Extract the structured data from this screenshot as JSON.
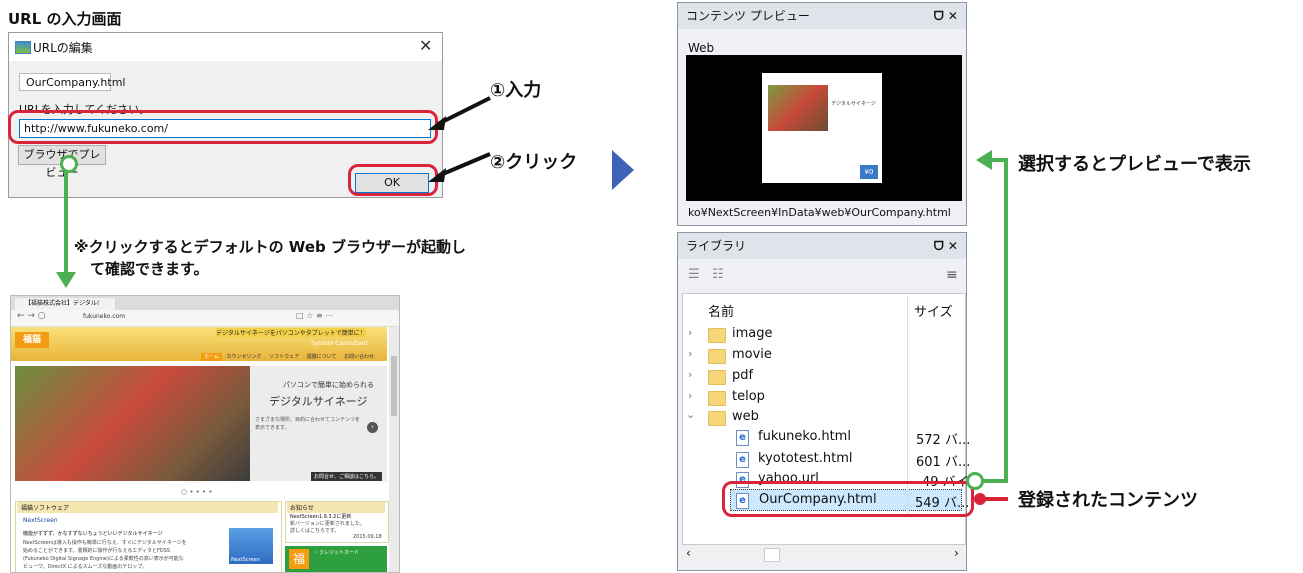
{
  "left_heading": "URL の入力画面",
  "dialog": {
    "title": "URLの編集",
    "name_value": "OurCompany.html",
    "url_label": "URLを入力してください。",
    "url_value": "http://www.fukuneko.com/",
    "preview_button": "ブラウザでプレビュー",
    "ok_button": "OK"
  },
  "annotations": {
    "step1": "①入力",
    "step2": "②クリック",
    "note_line1": "※クリックするとデフォルトの Web ブラウザーが起動し",
    "note_line2": "て確認できます。",
    "select_preview": "選択するとプレビューで表示",
    "registered": "登録されたコンテンツ"
  },
  "browser": {
    "tab_title": "【福猫株式会社】デジタル!",
    "address": "fukuneko.com",
    "banner_top": "デジタルサイネージをパソコンやタブレットで簡単に！",
    "banner_sub": "System Consultant",
    "logo_text": "福猫",
    "nav": [
      "ホーム",
      "カウンセリング",
      "ソフトウェア",
      "福猫について",
      "お問い合わせ"
    ],
    "hero_line1": "パソコンで簡単に始められる",
    "hero_line2": "デジタルサイネージ",
    "hero_line3": "さまざまな場所、目的に合わせてコンテンツを",
    "hero_line4": "表示できます。",
    "hero_link": "お問合せ、ご相談はこちら。",
    "dots": "○ • • • •",
    "software_title": "福猫ソフトウェア",
    "software_product": "NextScreen",
    "software_headline": "機能がすずず、かなすずないちょうどいいデジタルサイネージ",
    "software_body1": "NextScreenは導入も操作も簡単に行なえ、すぐにデジタルサイネージを",
    "software_body2": "始めることができます。書類的に操作が行なえるエディタとFDSS",
    "software_body3": "(Fukuneko Digital Signage Engine)による柔軟性の高い表示が可能な",
    "software_body4": "ビューワ。DirectX によるスムーズな動画のテロップ。",
    "news_title": "お知らせ",
    "news_line1": "NextScreen1.9.3.2に更新",
    "news_line2": "新バージョンに更新されました。",
    "news_line3": "詳しくはこちらです。",
    "news_date": "2015.09.18",
    "promo_text": "・クレジットカード",
    "promo_label": "NextScreen",
    "promo_logo": "福"
  },
  "preview_panel": {
    "title": "コンテンツ プレビュー",
    "controls": "ᗜ ✕",
    "web_label": "Web",
    "screen_title": "デジタルサイネージ",
    "screen_price": "¥0",
    "path": "ko¥NextScreen¥InData¥web¥OurCompany.html"
  },
  "library_panel": {
    "title": "ライブラリ",
    "controls": "ᗜ ✕",
    "col_name": "名前",
    "col_size": "サイズ",
    "folders": [
      "image",
      "movie",
      "pdf",
      "telop",
      "web"
    ],
    "files": [
      {
        "name": "fukuneko.html",
        "size": "572 バ..."
      },
      {
        "name": "kyototest.html",
        "size": "601 バ..."
      },
      {
        "name": "yahoo.url",
        "size": "49 バイ"
      },
      {
        "name": "OurCompany.html",
        "size": "549 バ..."
      }
    ]
  },
  "colors": {
    "accent_red": "#d9253b",
    "arrow_green": "#4caf50",
    "triangle_blue": "#3d63b8"
  }
}
